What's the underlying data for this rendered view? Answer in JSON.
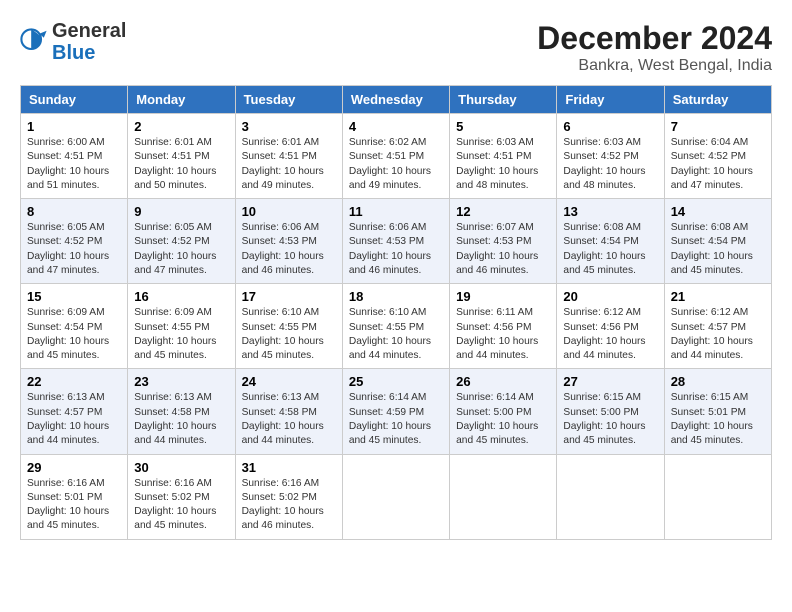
{
  "header": {
    "logo": {
      "general": "General",
      "blue": "Blue"
    },
    "title": "December 2024",
    "location": "Bankra, West Bengal, India"
  },
  "calendar": {
    "days_of_week": [
      "Sunday",
      "Monday",
      "Tuesday",
      "Wednesday",
      "Thursday",
      "Friday",
      "Saturday"
    ],
    "weeks": [
      [
        null,
        null,
        {
          "day": "3",
          "sunrise": "Sunrise: 6:01 AM",
          "sunset": "Sunset: 4:51 PM",
          "daylight": "Daylight: 10 hours and 49 minutes."
        },
        {
          "day": "4",
          "sunrise": "Sunrise: 6:02 AM",
          "sunset": "Sunset: 4:51 PM",
          "daylight": "Daylight: 10 hours and 49 minutes."
        },
        {
          "day": "5",
          "sunrise": "Sunrise: 6:03 AM",
          "sunset": "Sunset: 4:51 PM",
          "daylight": "Daylight: 10 hours and 48 minutes."
        },
        {
          "day": "6",
          "sunrise": "Sunrise: 6:03 AM",
          "sunset": "Sunset: 4:52 PM",
          "daylight": "Daylight: 10 hours and 48 minutes."
        },
        {
          "day": "7",
          "sunrise": "Sunrise: 6:04 AM",
          "sunset": "Sunset: 4:52 PM",
          "daylight": "Daylight: 10 hours and 47 minutes."
        }
      ],
      [
        {
          "day": "1",
          "sunrise": "Sunrise: 6:00 AM",
          "sunset": "Sunset: 4:51 PM",
          "daylight": "Daylight: 10 hours and 51 minutes."
        },
        {
          "day": "2",
          "sunrise": "Sunrise: 6:01 AM",
          "sunset": "Sunset: 4:51 PM",
          "daylight": "Daylight: 10 hours and 50 minutes."
        },
        null,
        null,
        null,
        null,
        null
      ],
      [
        {
          "day": "8",
          "sunrise": "Sunrise: 6:05 AM",
          "sunset": "Sunset: 4:52 PM",
          "daylight": "Daylight: 10 hours and 47 minutes."
        },
        {
          "day": "9",
          "sunrise": "Sunrise: 6:05 AM",
          "sunset": "Sunset: 4:52 PM",
          "daylight": "Daylight: 10 hours and 47 minutes."
        },
        {
          "day": "10",
          "sunrise": "Sunrise: 6:06 AM",
          "sunset": "Sunset: 4:53 PM",
          "daylight": "Daylight: 10 hours and 46 minutes."
        },
        {
          "day": "11",
          "sunrise": "Sunrise: 6:06 AM",
          "sunset": "Sunset: 4:53 PM",
          "daylight": "Daylight: 10 hours and 46 minutes."
        },
        {
          "day": "12",
          "sunrise": "Sunrise: 6:07 AM",
          "sunset": "Sunset: 4:53 PM",
          "daylight": "Daylight: 10 hours and 46 minutes."
        },
        {
          "day": "13",
          "sunrise": "Sunrise: 6:08 AM",
          "sunset": "Sunset: 4:54 PM",
          "daylight": "Daylight: 10 hours and 45 minutes."
        },
        {
          "day": "14",
          "sunrise": "Sunrise: 6:08 AM",
          "sunset": "Sunset: 4:54 PM",
          "daylight": "Daylight: 10 hours and 45 minutes."
        }
      ],
      [
        {
          "day": "15",
          "sunrise": "Sunrise: 6:09 AM",
          "sunset": "Sunset: 4:54 PM",
          "daylight": "Daylight: 10 hours and 45 minutes."
        },
        {
          "day": "16",
          "sunrise": "Sunrise: 6:09 AM",
          "sunset": "Sunset: 4:55 PM",
          "daylight": "Daylight: 10 hours and 45 minutes."
        },
        {
          "day": "17",
          "sunrise": "Sunrise: 6:10 AM",
          "sunset": "Sunset: 4:55 PM",
          "daylight": "Daylight: 10 hours and 45 minutes."
        },
        {
          "day": "18",
          "sunrise": "Sunrise: 6:10 AM",
          "sunset": "Sunset: 4:55 PM",
          "daylight": "Daylight: 10 hours and 44 minutes."
        },
        {
          "day": "19",
          "sunrise": "Sunrise: 6:11 AM",
          "sunset": "Sunset: 4:56 PM",
          "daylight": "Daylight: 10 hours and 44 minutes."
        },
        {
          "day": "20",
          "sunrise": "Sunrise: 6:12 AM",
          "sunset": "Sunset: 4:56 PM",
          "daylight": "Daylight: 10 hours and 44 minutes."
        },
        {
          "day": "21",
          "sunrise": "Sunrise: 6:12 AM",
          "sunset": "Sunset: 4:57 PM",
          "daylight": "Daylight: 10 hours and 44 minutes."
        }
      ],
      [
        {
          "day": "22",
          "sunrise": "Sunrise: 6:13 AM",
          "sunset": "Sunset: 4:57 PM",
          "daylight": "Daylight: 10 hours and 44 minutes."
        },
        {
          "day": "23",
          "sunrise": "Sunrise: 6:13 AM",
          "sunset": "Sunset: 4:58 PM",
          "daylight": "Daylight: 10 hours and 44 minutes."
        },
        {
          "day": "24",
          "sunrise": "Sunrise: 6:13 AM",
          "sunset": "Sunset: 4:58 PM",
          "daylight": "Daylight: 10 hours and 44 minutes."
        },
        {
          "day": "25",
          "sunrise": "Sunrise: 6:14 AM",
          "sunset": "Sunset: 4:59 PM",
          "daylight": "Daylight: 10 hours and 45 minutes."
        },
        {
          "day": "26",
          "sunrise": "Sunrise: 6:14 AM",
          "sunset": "Sunset: 5:00 PM",
          "daylight": "Daylight: 10 hours and 45 minutes."
        },
        {
          "day": "27",
          "sunrise": "Sunrise: 6:15 AM",
          "sunset": "Sunset: 5:00 PM",
          "daylight": "Daylight: 10 hours and 45 minutes."
        },
        {
          "day": "28",
          "sunrise": "Sunrise: 6:15 AM",
          "sunset": "Sunset: 5:01 PM",
          "daylight": "Daylight: 10 hours and 45 minutes."
        }
      ],
      [
        {
          "day": "29",
          "sunrise": "Sunrise: 6:16 AM",
          "sunset": "Sunset: 5:01 PM",
          "daylight": "Daylight: 10 hours and 45 minutes."
        },
        {
          "day": "30",
          "sunrise": "Sunrise: 6:16 AM",
          "sunset": "Sunset: 5:02 PM",
          "daylight": "Daylight: 10 hours and 45 minutes."
        },
        {
          "day": "31",
          "sunrise": "Sunrise: 6:16 AM",
          "sunset": "Sunset: 5:02 PM",
          "daylight": "Daylight: 10 hours and 46 minutes."
        },
        null,
        null,
        null,
        null
      ]
    ]
  }
}
